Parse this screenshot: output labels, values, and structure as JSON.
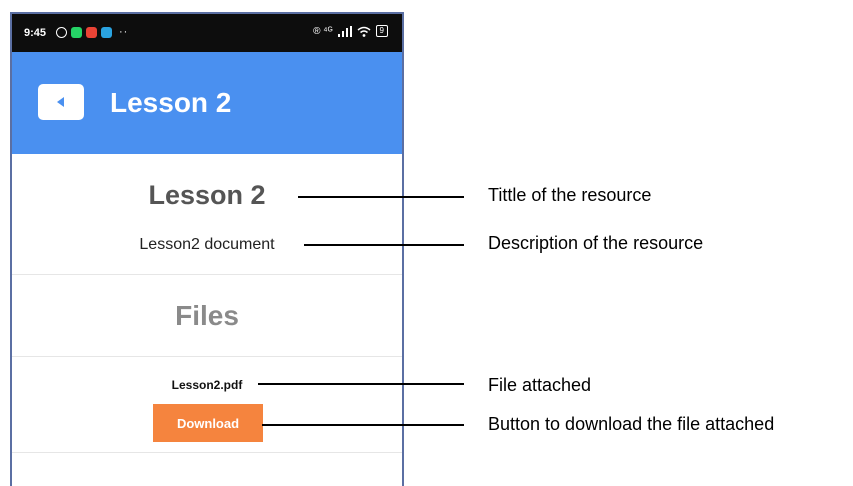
{
  "status_bar": {
    "time": "9:45",
    "dots": "··",
    "right_text": "® ⁴ᴳ",
    "battery": "9"
  },
  "app_bar": {
    "title": "Lesson 2",
    "background_color": "#4a90f0"
  },
  "resource": {
    "title": "Lesson 2",
    "description": "Lesson2 document"
  },
  "files": {
    "heading": "Files",
    "items": [
      {
        "name": "Lesson2.pdf",
        "button_label": "Download",
        "button_color": "#f5843e"
      }
    ]
  },
  "annotations": [
    {
      "text": "Tittle of the resource"
    },
    {
      "text": "Description of the resource"
    },
    {
      "text": "File attached"
    },
    {
      "text": "Button to download the file attached"
    }
  ]
}
